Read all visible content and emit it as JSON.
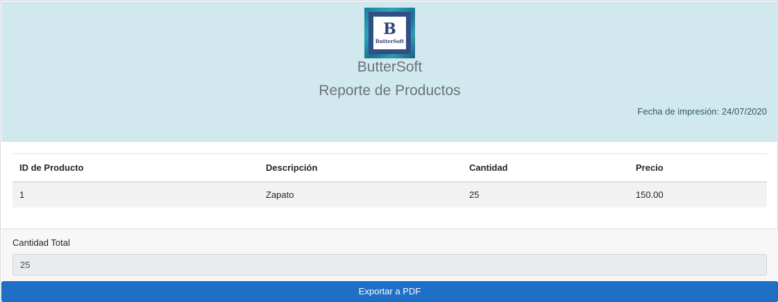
{
  "header": {
    "logo": {
      "letter": "B",
      "name": "ButterSoft"
    },
    "company_name": "ButterSoft",
    "report_title": "Reporte de Productos",
    "print_date": "Fecha de impresión: 24/07/2020"
  },
  "table": {
    "columns": [
      "ID de Producto",
      "Descripción",
      "Cantidad",
      "Precio"
    ],
    "rows": [
      {
        "id": "1",
        "description": "Zapato",
        "quantity": "25",
        "price": "150.00"
      }
    ]
  },
  "footer": {
    "total_label": "Cantidad Total",
    "total_value": "25"
  },
  "actions": {
    "export_label": "Exportar a PDF"
  },
  "colors": {
    "header_bg": "#d1e9ee",
    "button_bg": "#1f6fc6",
    "row_bg": "#f2f2f2"
  }
}
